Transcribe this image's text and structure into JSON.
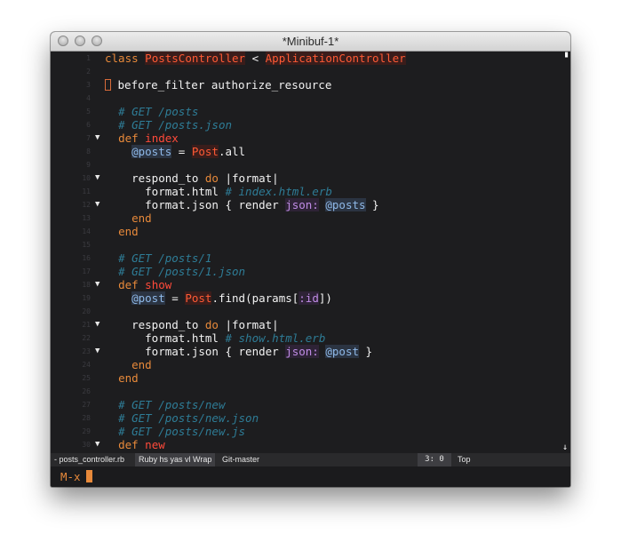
{
  "window": {
    "title": "*Minibuf-1*"
  },
  "editor": {
    "lines": [
      {
        "n": "1",
        "fold": ""
      },
      {
        "n": "2",
        "fold": ""
      },
      {
        "n": "3",
        "fold": ""
      },
      {
        "n": "4",
        "fold": ""
      },
      {
        "n": "5",
        "fold": ""
      },
      {
        "n": "6",
        "fold": ""
      },
      {
        "n": "7",
        "fold": "▼"
      },
      {
        "n": "8",
        "fold": ""
      },
      {
        "n": "9",
        "fold": ""
      },
      {
        "n": "10",
        "fold": "▼"
      },
      {
        "n": "11",
        "fold": ""
      },
      {
        "n": "12",
        "fold": "▼"
      },
      {
        "n": "13",
        "fold": ""
      },
      {
        "n": "14",
        "fold": ""
      },
      {
        "n": "15",
        "fold": ""
      },
      {
        "n": "16",
        "fold": ""
      },
      {
        "n": "17",
        "fold": ""
      },
      {
        "n": "18",
        "fold": "▼"
      },
      {
        "n": "19",
        "fold": ""
      },
      {
        "n": "20",
        "fold": ""
      },
      {
        "n": "21",
        "fold": "▼"
      },
      {
        "n": "22",
        "fold": ""
      },
      {
        "n": "23",
        "fold": "▼"
      },
      {
        "n": "24",
        "fold": ""
      },
      {
        "n": "25",
        "fold": ""
      },
      {
        "n": "26",
        "fold": ""
      },
      {
        "n": "27",
        "fold": ""
      },
      {
        "n": "28",
        "fold": ""
      },
      {
        "n": "29",
        "fold": ""
      },
      {
        "n": "30",
        "fold": "▼"
      }
    ],
    "tokens": {
      "l1_class": "class",
      "l1_name": "PostsController",
      "l1_lt": " < ",
      "l1_parent": "ApplicationController",
      "l3_text": " before_filter authorize_resource",
      "l5": "# GET /posts",
      "l6": "# GET /posts.json",
      "l7_def": "def",
      "l7_name": "index",
      "l8_iv": "@posts",
      "l8_eq": " = ",
      "l8_cls": "Post",
      "l8_rest": ".all",
      "l10_a": "respond_to ",
      "l10_do": "do",
      "l10_b": " |format|",
      "l11_a": "format.html ",
      "l11_c": "# index.html.erb",
      "l12_a": "format.json { render ",
      "l12_sym": "json:",
      "l12_sp": " ",
      "l12_iv": "@posts",
      "l12_b": " }",
      "l13_end": "end",
      "l14_end": "end",
      "l16": "# GET /posts/1",
      "l17": "# GET /posts/1.json",
      "l18_def": "def",
      "l18_name": "show",
      "l19_iv": "@post",
      "l19_eq": " = ",
      "l19_cls": "Post",
      "l19_a": ".find(params[",
      "l19_sym": ":id",
      "l19_b": "])",
      "l21_a": "respond_to ",
      "l21_do": "do",
      "l21_b": " |format|",
      "l22_a": "format.html ",
      "l22_c": "# show.html.erb",
      "l23_a": "format.json { render ",
      "l23_sym": "json:",
      "l23_sp": " ",
      "l23_iv": "@post",
      "l23_b": " }",
      "l24_end": "end",
      "l25_end": "end",
      "l27": "# GET /posts/new",
      "l28": "# GET /posts/new.json",
      "l29": "# GET /posts/new.js",
      "l30_def": "def",
      "l30_name": "new"
    },
    "corner_top": "▝",
    "corner_bottom": "↓"
  },
  "modeline": {
    "file": "- posts_controller.rb",
    "mode": "Ruby hs yas vl Wrap",
    "branch": "Git-master",
    "position": "3: 0",
    "scroll": "Top"
  },
  "minibuffer": {
    "prompt": "M-x"
  },
  "colors": {
    "keyword": "#e7893a",
    "class": "#ff5a35",
    "comment": "#2e7c96",
    "ivar": "#8fb9e8",
    "symbol": "#c08ce6",
    "background": "#1d1d1f"
  }
}
